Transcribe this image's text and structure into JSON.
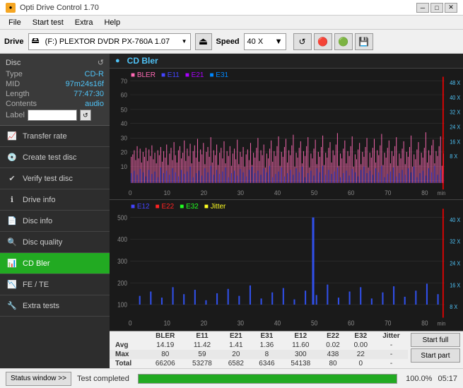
{
  "title_bar": {
    "icon": "●",
    "title": "Opti Drive Control 1.70",
    "min_btn": "─",
    "max_btn": "□",
    "close_btn": "✕"
  },
  "menu": {
    "items": [
      "File",
      "Start test",
      "Extra",
      "Help"
    ]
  },
  "toolbar": {
    "drive_label": "Drive",
    "drive_value": "(F:)  PLEXTOR DVDR  PX-760A 1.07",
    "speed_label": "Speed",
    "speed_value": "40 X"
  },
  "disc": {
    "header": "Disc",
    "type_label": "Type",
    "type_value": "CD-R",
    "mid_label": "MID",
    "mid_value": "97m24s16f",
    "length_label": "Length",
    "length_value": "77:47:30",
    "contents_label": "Contents",
    "contents_value": "audio",
    "label_label": "Label"
  },
  "nav_items": [
    {
      "id": "transfer-rate",
      "label": "Transfer rate",
      "icon": "📈"
    },
    {
      "id": "create-test-disc",
      "label": "Create test disc",
      "icon": "💿"
    },
    {
      "id": "verify-test-disc",
      "label": "Verify test disc",
      "icon": "✔"
    },
    {
      "id": "drive-info",
      "label": "Drive info",
      "icon": "ℹ"
    },
    {
      "id": "disc-info",
      "label": "Disc info",
      "icon": "📄"
    },
    {
      "id": "disc-quality",
      "label": "Disc quality",
      "icon": "🔍"
    },
    {
      "id": "cd-bler",
      "label": "CD Bler",
      "icon": "📊",
      "active": true
    },
    {
      "id": "fe-te",
      "label": "FE / TE",
      "icon": "📉"
    },
    {
      "id": "extra-tests",
      "label": "Extra tests",
      "icon": "🔧"
    }
  ],
  "chart": {
    "title": "CD Bler",
    "top_legend": [
      "BLER",
      "E11",
      "E21",
      "E31"
    ],
    "top_legend_colors": [
      "#ff69b4",
      "#0000ff",
      "#8800ff",
      "#0088ff"
    ],
    "bottom_legend": [
      "E12",
      "E22",
      "E32",
      "Jitter"
    ],
    "bottom_legend_colors": [
      "#0000ff",
      "#ff0000",
      "#00ff00",
      "#ffff00"
    ],
    "top_y_max": 500,
    "top_y_labels": [
      "70",
      "60",
      "50",
      "40",
      "30",
      "20",
      "10"
    ],
    "bottom_y_max": 500,
    "bottom_y_labels": [
      "400",
      "300",
      "200",
      "100"
    ],
    "x_labels": [
      "0",
      "10",
      "20",
      "30",
      "40",
      "50",
      "60",
      "70",
      "80"
    ],
    "x_label": "min",
    "right_labels_top": [
      "48 X",
      "40 X",
      "32 X",
      "24 X",
      "16 X",
      "8 X"
    ],
    "right_labels_bottom": [
      "40 X",
      "32 X",
      "24 X",
      "16 X",
      "8 X"
    ]
  },
  "stats": {
    "headers": [
      "",
      "BLER",
      "E11",
      "E21",
      "E31",
      "E12",
      "E22",
      "E32",
      "Jitter",
      ""
    ],
    "rows": [
      {
        "label": "Avg",
        "values": [
          "14.19",
          "11.42",
          "1.41",
          "1.36",
          "11.60",
          "0.02",
          "0.00",
          "-"
        ]
      },
      {
        "label": "Max",
        "values": [
          "80",
          "59",
          "20",
          "8",
          "300",
          "438",
          "22",
          "-"
        ]
      },
      {
        "label": "Total",
        "values": [
          "66206",
          "53278",
          "6582",
          "6346",
          "54138",
          "80",
          "0",
          "-"
        ]
      }
    ],
    "start_full_label": "Start full",
    "start_part_label": "Start part"
  },
  "status": {
    "window_btn": "Status window >>",
    "completed_text": "Test completed",
    "progress": 100,
    "progress_text": "100.0%",
    "time": "05:17"
  }
}
